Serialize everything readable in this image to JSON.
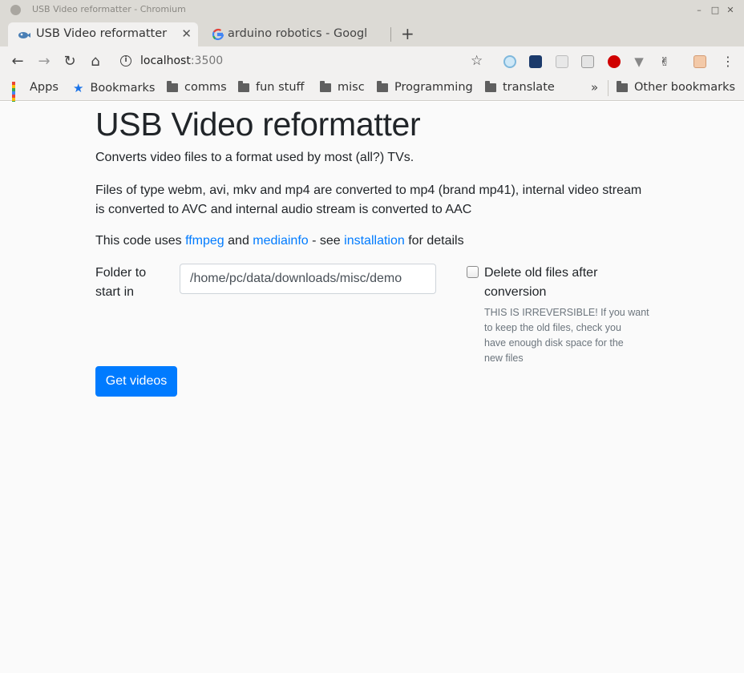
{
  "window": {
    "title": "USB Video reformatter - Chromium"
  },
  "tabs": [
    {
      "label": "USB Video reformatter",
      "active": true
    },
    {
      "label": "arduino robotics - Google",
      "active": false
    }
  ],
  "toolbar": {
    "url_host": "localhost",
    "url_port": ":3500"
  },
  "bookmarks": {
    "apps": "Apps",
    "items": [
      "Bookmarks",
      "comms",
      "fun stuff",
      "misc",
      "Programming",
      "translate"
    ],
    "other": "Other bookmarks"
  },
  "page": {
    "title": "USB Video reformatter",
    "intro": "Converts video files to a format used by most (all?) TVs.",
    "desc_line1": "Files of type webm, avi, mkv and mp4 are converted to mp4 (brand mp41), internal video stream",
    "desc_line2": "is converted to AVC and internal audio stream is converted to AAC",
    "uses_prefix": "This code uses",
    "link_ffmpeg": "ffmpeg",
    "and": "and",
    "link_mediainfo": "mediainfo",
    "see": "- see",
    "link_installation": "installation",
    "for_details": "for details",
    "folder_label_line1": "Folder to",
    "folder_label_line2": "start in",
    "folder_value": "/home/pc/data/downloads/misc/demo",
    "delete_label_line1": "Delete old files after",
    "delete_label_line2": "conversion",
    "delete_checked": false,
    "warning_line1": "THIS IS IRREVERSIBLE! If you want",
    "warning_line2": "to keep the old files, check you",
    "warning_line3": "have enough disk space for the",
    "warning_line4": "new files",
    "button": "Get videos"
  },
  "colors": {
    "link": "#007bff",
    "button_bg": "#007bff",
    "text": "#212529",
    "muted": "#6c757d"
  }
}
